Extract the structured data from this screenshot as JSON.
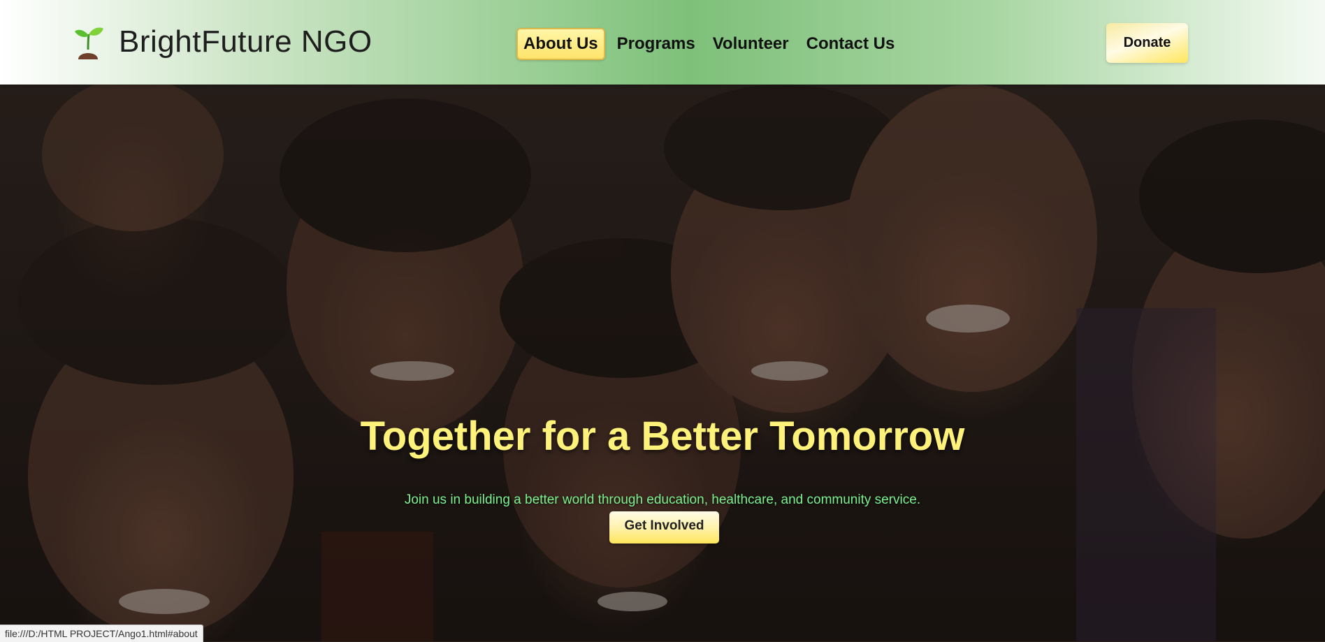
{
  "header": {
    "brand_name": "BrightFuture NGO",
    "logo_icon": "seedling-icon",
    "nav": [
      {
        "label": "About Us",
        "active": true
      },
      {
        "label": "Programs",
        "active": false
      },
      {
        "label": "Volunteer",
        "active": false
      },
      {
        "label": "Contact Us",
        "active": false
      }
    ],
    "donate_label": "Donate"
  },
  "hero": {
    "title": "Together for a Better Tomorrow",
    "subtitle": "Join us in building a better world through education, healthcare, and community service.",
    "cta_label": "Get Involved",
    "background_image": "group-of-smiling-children-photo"
  },
  "status_bar": {
    "url": "file:///D:/HTML PROJECT/Ango1.html#about"
  },
  "colors": {
    "header_green": "#8fc98a",
    "accent_yellow": "#ffe65c",
    "title_yellow": "#fff27a",
    "subtitle_green": "#7cf28f"
  }
}
